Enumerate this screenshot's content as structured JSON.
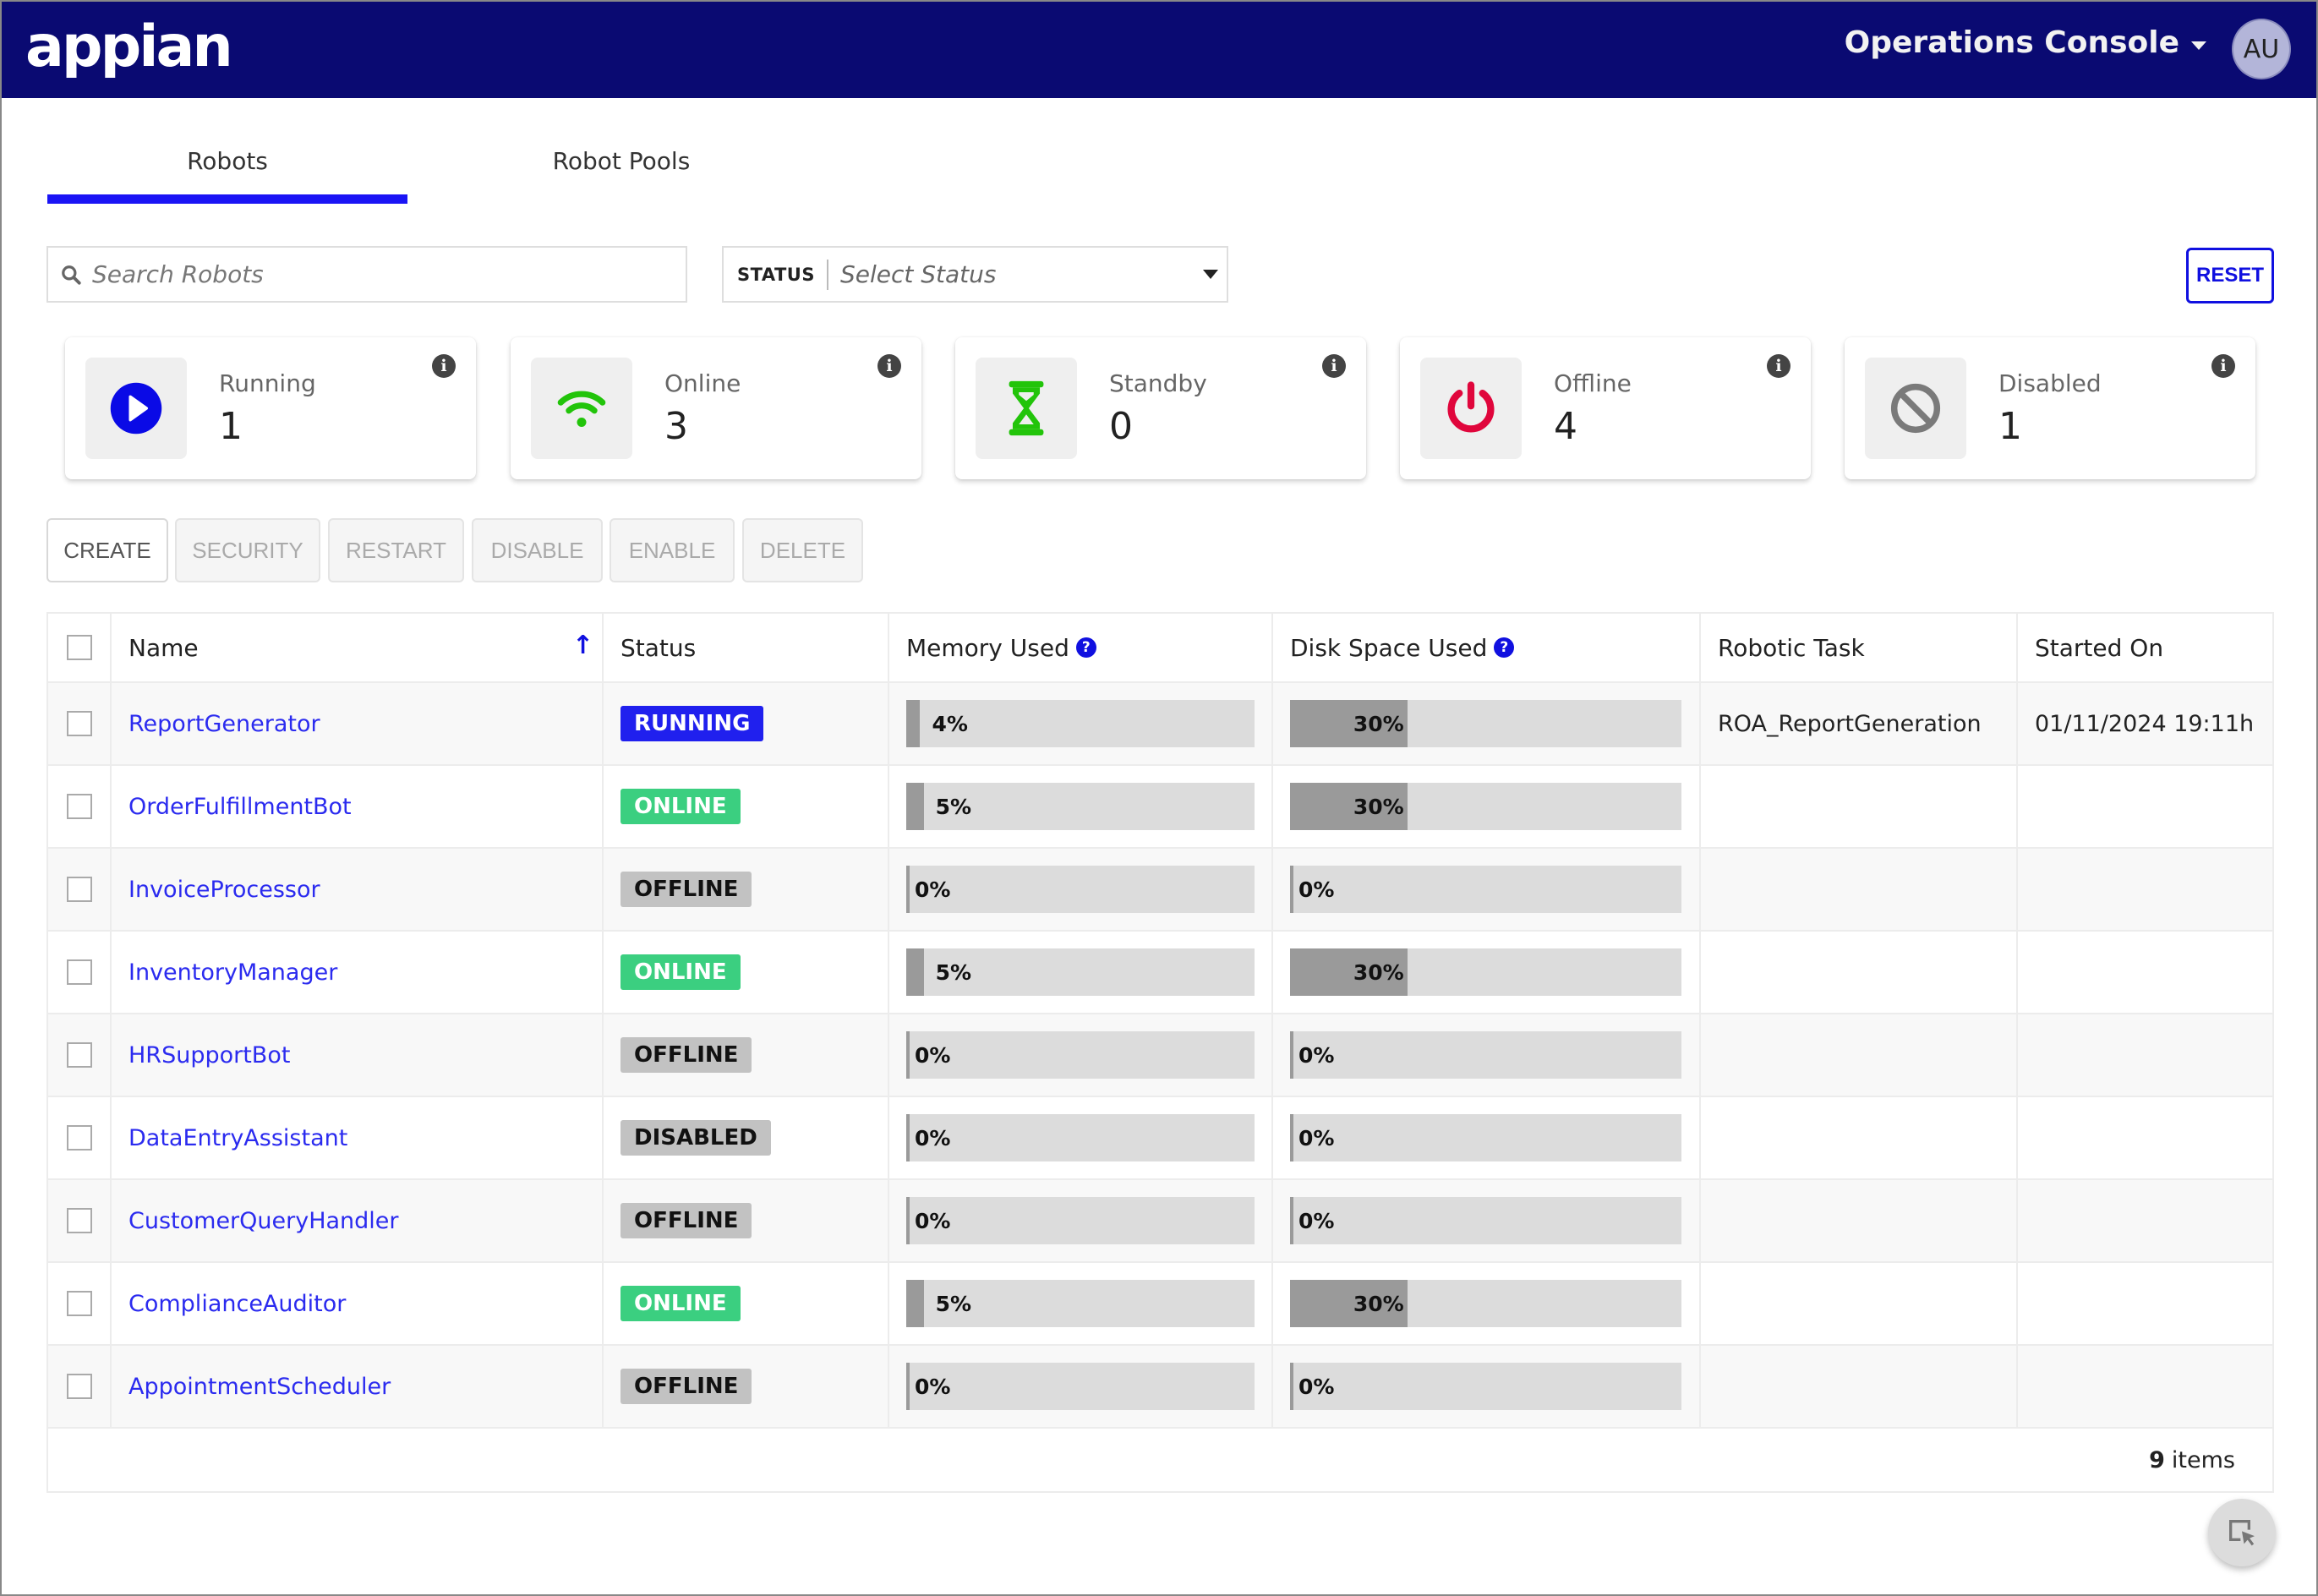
{
  "header": {
    "logo": "appian",
    "app_menu": "Operations Console",
    "user_initials": "AU",
    "colors": {
      "bar": "#0a0a72",
      "accent": "#1a14f5"
    }
  },
  "tabs": [
    {
      "label": "Robots",
      "active": true
    },
    {
      "label": "Robot Pools",
      "active": false
    }
  ],
  "filters": {
    "search_placeholder": "Search Robots",
    "search_value": "",
    "status_label": "STATUS",
    "status_placeholder": "Select Status",
    "reset_label": "RESET"
  },
  "cards": [
    {
      "label": "Running",
      "value": "1",
      "icon": "play-circle-icon",
      "color": "#0a0ae6"
    },
    {
      "label": "Online",
      "value": "3",
      "icon": "wifi-icon",
      "color": "#22c40a"
    },
    {
      "label": "Standby",
      "value": "0",
      "icon": "hourglass-icon",
      "color": "#22c40a"
    },
    {
      "label": "Offline",
      "value": "4",
      "icon": "power-icon",
      "color": "#e0063c"
    },
    {
      "label": "Disabled",
      "value": "1",
      "icon": "ban-icon",
      "color": "#7a7a7a"
    }
  ],
  "actions": [
    {
      "label": "CREATE",
      "enabled": true
    },
    {
      "label": "SECURITY",
      "enabled": false
    },
    {
      "label": "RESTART",
      "enabled": false
    },
    {
      "label": "DISABLE",
      "enabled": false
    },
    {
      "label": "ENABLE",
      "enabled": false
    },
    {
      "label": "DELETE",
      "enabled": false
    }
  ],
  "table": {
    "columns": [
      "Name",
      "Status",
      "Memory Used",
      "Disk Space Used",
      "Robotic Task",
      "Started On"
    ],
    "sort": {
      "column": "Name",
      "direction": "ascending"
    },
    "rows": [
      {
        "name": "ReportGenerator",
        "status": "RUNNING",
        "memory": 4,
        "memory_label": "4%",
        "disk": 30,
        "disk_label": "30%",
        "task": "ROA_ReportGeneration",
        "started": "01/11/2024 19:11h"
      },
      {
        "name": "OrderFulfillmentBot",
        "status": "ONLINE",
        "memory": 5,
        "memory_label": "5%",
        "disk": 30,
        "disk_label": "30%",
        "task": "",
        "started": ""
      },
      {
        "name": "InvoiceProcessor",
        "status": "OFFLINE",
        "memory": 0,
        "memory_label": "0%",
        "disk": 0,
        "disk_label": "0%",
        "task": "",
        "started": ""
      },
      {
        "name": "InventoryManager",
        "status": "ONLINE",
        "memory": 5,
        "memory_label": "5%",
        "disk": 30,
        "disk_label": "30%",
        "task": "",
        "started": ""
      },
      {
        "name": "HRSupportBot",
        "status": "OFFLINE",
        "memory": 0,
        "memory_label": "0%",
        "disk": 0,
        "disk_label": "0%",
        "task": "",
        "started": ""
      },
      {
        "name": "DataEntryAssistant",
        "status": "DISABLED",
        "memory": 0,
        "memory_label": "0%",
        "disk": 0,
        "disk_label": "0%",
        "task": "",
        "started": ""
      },
      {
        "name": "CustomerQueryHandler",
        "status": "OFFLINE",
        "memory": 0,
        "memory_label": "0%",
        "disk": 0,
        "disk_label": "0%",
        "task": "",
        "started": ""
      },
      {
        "name": "ComplianceAuditor",
        "status": "ONLINE",
        "memory": 5,
        "memory_label": "5%",
        "disk": 30,
        "disk_label": "30%",
        "task": "",
        "started": ""
      },
      {
        "name": "AppointmentScheduler",
        "status": "OFFLINE",
        "memory": 0,
        "memory_label": "0%",
        "disk": 0,
        "disk_label": "0%",
        "task": "",
        "started": ""
      }
    ],
    "footer_count": "9",
    "footer_suffix": "items"
  },
  "fab": {
    "icon": "select-cursor-icon"
  }
}
